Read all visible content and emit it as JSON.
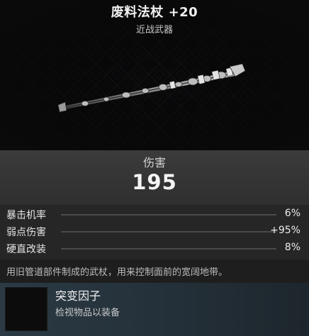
{
  "item": {
    "name": "废料法杖 +20",
    "type": "近战武器"
  },
  "damage": {
    "label": "伤害",
    "value": "195"
  },
  "stats": [
    {
      "name": "暴击机率",
      "value": "6%"
    },
    {
      "name": "弱点伤害",
      "value": "+95%"
    },
    {
      "name": "硬直改装",
      "value": "8%"
    }
  ],
  "description": "用旧管道部件制成的武杖，用来控制面前的宽阔地带。",
  "mod_slot": {
    "title": "突变因子",
    "hint": "检视物品以装备"
  },
  "colors": {
    "background": "#0d0d0e",
    "damage_panel": "#353535",
    "stats_panel": "#262626",
    "mod_panel": "#2b3a44"
  },
  "icons": {
    "weapon": "scrap-staff-icon",
    "mod_slot": "empty-mutator-slot-icon"
  }
}
